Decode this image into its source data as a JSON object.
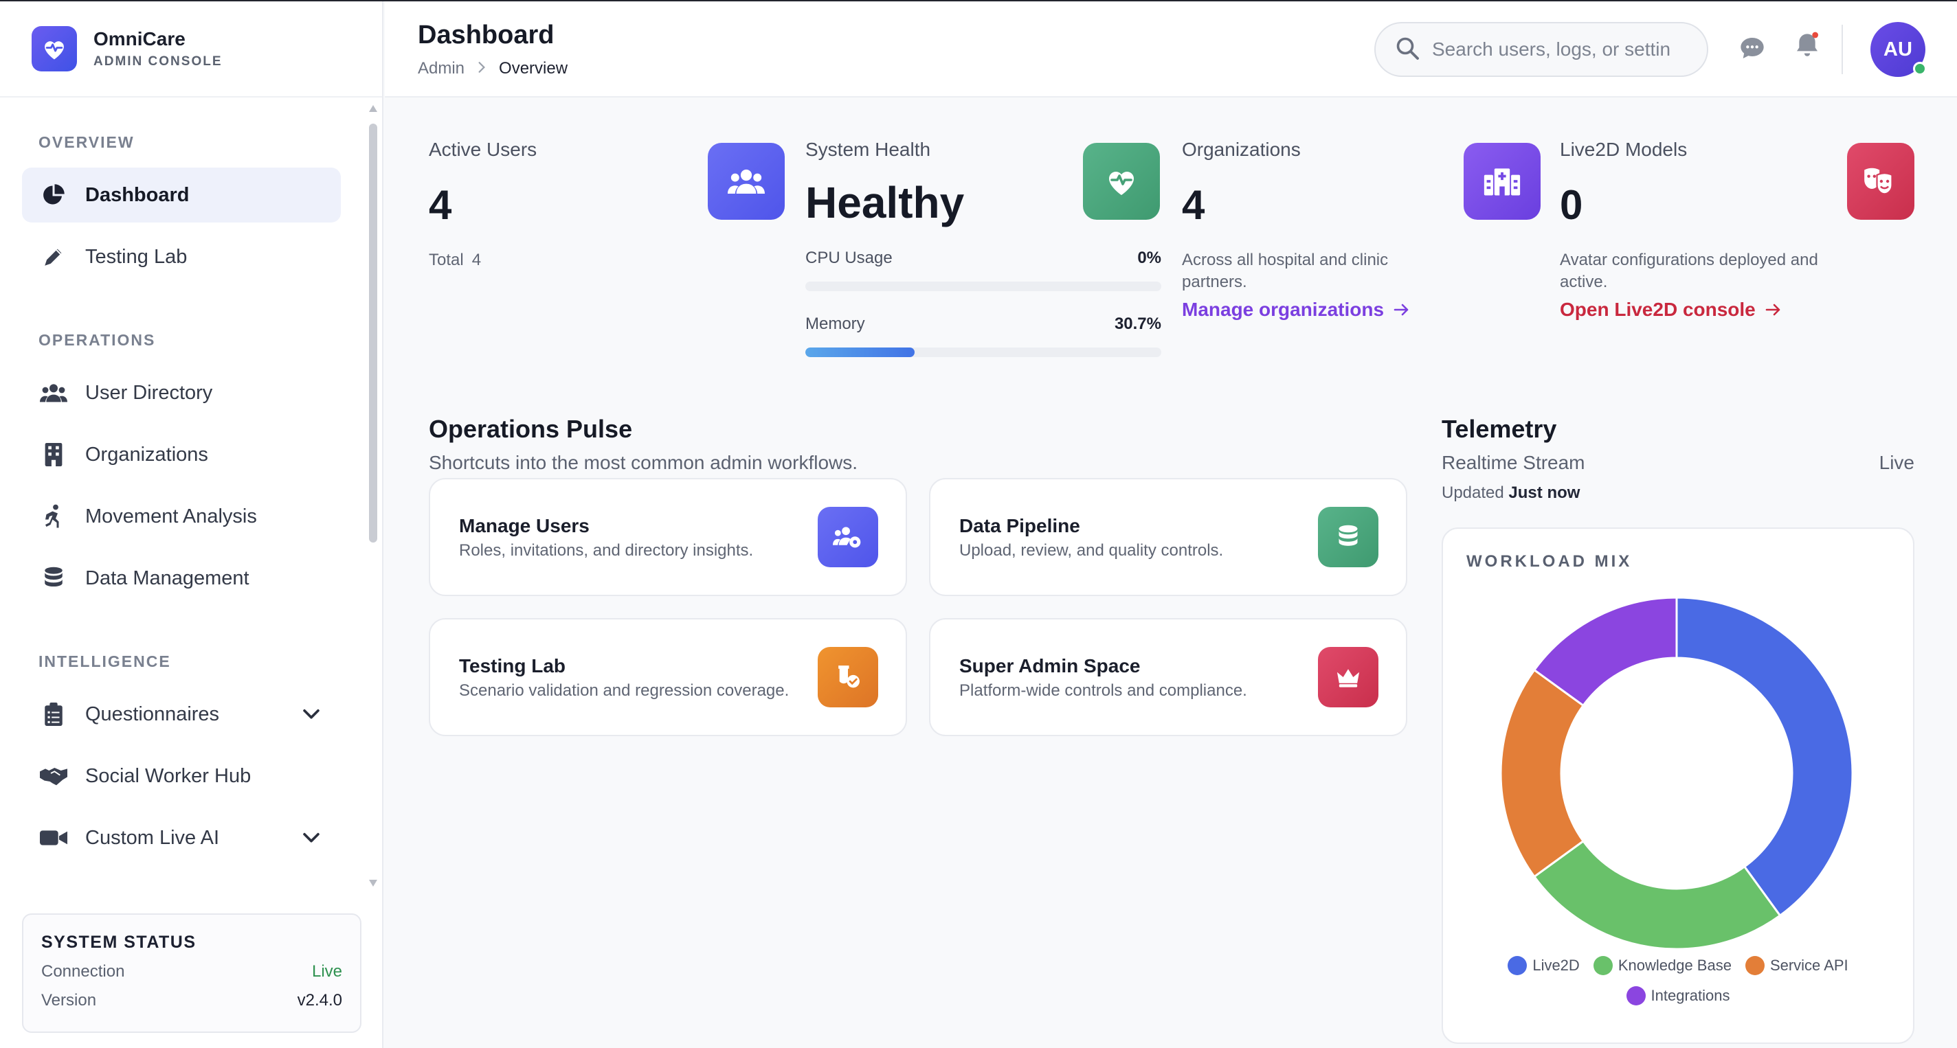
{
  "brand": {
    "name": "OmniCare",
    "subtitle": "ADMIN CONSOLE"
  },
  "sidebar": {
    "sections": [
      {
        "title": "OVERVIEW",
        "items": [
          {
            "label": "Dashboard",
            "icon": "pie-chart-icon",
            "active": true
          },
          {
            "label": "Testing Lab",
            "icon": "pen-icon"
          }
        ]
      },
      {
        "title": "OPERATIONS",
        "items": [
          {
            "label": "User Directory",
            "icon": "users-icon"
          },
          {
            "label": "Organizations",
            "icon": "building-icon"
          },
          {
            "label": "Movement Analysis",
            "icon": "running-icon"
          },
          {
            "label": "Data Management",
            "icon": "database-icon"
          }
        ]
      },
      {
        "title": "INTELLIGENCE",
        "items": [
          {
            "label": "Questionnaires",
            "icon": "clipboard-icon",
            "expandable": true
          },
          {
            "label": "Social Worker Hub",
            "icon": "handshake-icon"
          },
          {
            "label": "Custom Live AI",
            "icon": "video-icon",
            "expandable": true
          }
        ]
      }
    ],
    "system_status": {
      "title": "SYSTEM STATUS",
      "connection_label": "Connection",
      "connection_value": "Live",
      "version_label": "Version",
      "version_value": "v2.4.0"
    }
  },
  "header": {
    "title": "Dashboard",
    "breadcrumb": [
      "Admin",
      "Overview"
    ],
    "search_placeholder": "Search users, logs, or settin",
    "avatar_initials": "AU"
  },
  "stats": {
    "active_users": {
      "label": "Active Users",
      "value": "4",
      "sub_label": "Total",
      "sub_value": "4",
      "icon": "users-icon",
      "color": "#5a5ff0"
    },
    "system_health": {
      "label": "System Health",
      "value": "Healthy",
      "icon": "heart-pulse-icon",
      "color": "#4aa77c",
      "cpu_label": "CPU Usage",
      "cpu_value": "0%",
      "cpu_fraction": 0.0,
      "memory_label": "Memory",
      "memory_value": "30.7%",
      "memory_fraction": 0.307
    },
    "organizations": {
      "label": "Organizations",
      "value": "4",
      "description": "Across all hospital and clinic partners.",
      "link": "Manage organizations",
      "link_color": "#7b3fe0",
      "icon": "hospital-icon",
      "color": "#7a4ce6"
    },
    "live2d": {
      "label": "Live2D Models",
      "value": "0",
      "description": "Avatar configurations deployed and active.",
      "link": "Open Live2D console",
      "link_color": "#c9283e",
      "icon": "masks-icon",
      "color": "#d93a5a"
    }
  },
  "operations": {
    "title": "Operations Pulse",
    "subtitle": "Shortcuts into the most common admin workflows.",
    "cards": [
      {
        "title": "Manage Users",
        "description": "Roles, invitations, and directory insights.",
        "icon": "users-gear-icon",
        "color": "#5a5ff0"
      },
      {
        "title": "Data Pipeline",
        "description": "Upload, review, and quality controls.",
        "icon": "database-icon",
        "color": "#4aa77c"
      },
      {
        "title": "Testing Lab",
        "description": "Scenario validation and regression coverage.",
        "icon": "vial-check-icon",
        "color": "#e8832a"
      },
      {
        "title": "Super Admin Space",
        "description": "Platform-wide controls and compliance.",
        "icon": "crown-icon",
        "color": "#d93a5a"
      }
    ]
  },
  "telemetry": {
    "title": "Telemetry",
    "stream": "Realtime Stream",
    "live": "Live",
    "updated_label": "Updated",
    "updated_value": "Just now",
    "card_title": "WORKLOAD MIX"
  },
  "chart_data": {
    "type": "pie",
    "categories": [
      "Live2D",
      "Knowledge Base",
      "Service API",
      "Integrations"
    ],
    "values": [
      40,
      25,
      20,
      15
    ],
    "colors": [
      "#4a6ae4",
      "#69c16a",
      "#e37e38",
      "#8b45e0"
    ],
    "legend": "bottom"
  }
}
